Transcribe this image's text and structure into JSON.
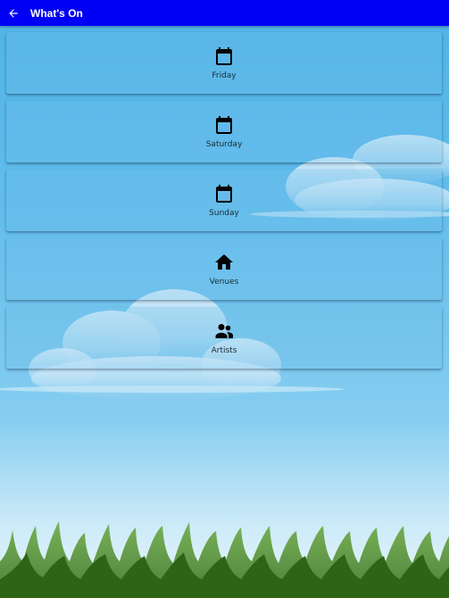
{
  "app_bar": {
    "title": "What's On",
    "back_icon": "arrow-left-icon",
    "color": "#0000f5"
  },
  "menu": {
    "items": [
      {
        "label": "Friday",
        "icon": "calendar-icon"
      },
      {
        "label": "Saturday",
        "icon": "calendar-icon"
      },
      {
        "label": "Sunday",
        "icon": "calendar-icon"
      },
      {
        "label": "Venues",
        "icon": "home-icon"
      },
      {
        "label": "Artists",
        "icon": "people-icon"
      }
    ]
  },
  "background": {
    "sky_color": "#4fb2e6",
    "grass_color": "#4f8f2a"
  }
}
